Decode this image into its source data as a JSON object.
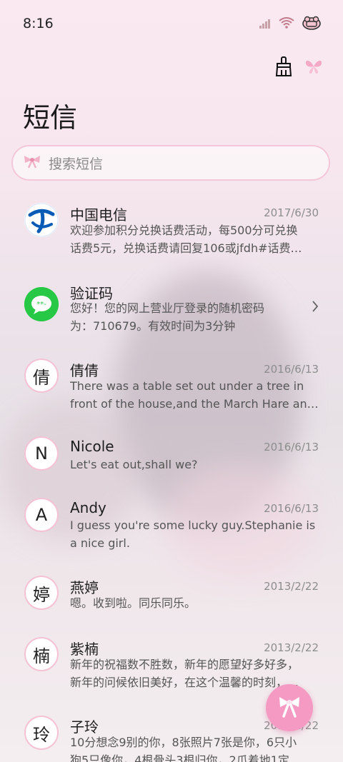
{
  "status": {
    "time": "8:16"
  },
  "header": {
    "title": "短信"
  },
  "search": {
    "placeholder": "搜索短信"
  },
  "conversations": [
    {
      "avatar": "",
      "name": "中国电信",
      "date": "2017/6/30",
      "line1": "欢迎参加积分兑换话费活动，每500分可兑换",
      "line2": "话费5元，兑换话费请回复106或jfdh#话费…"
    },
    {
      "avatar": "",
      "name": "验证码",
      "date": "",
      "line1": "您好！您的网上营业厅登录的随机密码",
      "line2": "为：710679。有效时间为3分钟"
    },
    {
      "avatar": "倩",
      "name": "倩倩",
      "date": "2016/6/13",
      "line1": "There was a table set out under a tree in",
      "line2": "front of the house,and the March Hare an…"
    },
    {
      "avatar": "N",
      "name": "Nicole",
      "date": "2016/6/13",
      "line1": "Let's eat out,shall we?",
      "line2": ""
    },
    {
      "avatar": "A",
      "name": "Andy",
      "date": "2016/6/13",
      "line1": "I guess you're some lucky guy.Stephanie is",
      "line2": "a nice girl."
    },
    {
      "avatar": "婷",
      "name": "燕婷",
      "date": "2013/2/22",
      "line1": "嗯。收到啦。同乐同乐。",
      "line2": ""
    },
    {
      "avatar": "楠",
      "name": "紫楠",
      "date": "2013/2/22",
      "line1": "新年的祝福数不胜数，新年的愿望好多好多，",
      "line2": "新年的问候依旧美好，在这个温馨的时刻，…"
    },
    {
      "avatar": "玲",
      "name": "子玲",
      "date": "2013/2/22",
      "line1": "10分想念9别的你，8张照片7张是你，6只小",
      "line2": "狗5只像你，4根骨头3根归你，2爪着地1定…"
    }
  ],
  "icons": {
    "cleaner": "broom-icon",
    "theme": "butterfly-icon",
    "search": "bow-icon",
    "chevron": "chevron-right-icon",
    "fab": "bow-compose-icon"
  },
  "colors": {
    "accent": "#f59bc3",
    "border": "#f3c7d7"
  }
}
